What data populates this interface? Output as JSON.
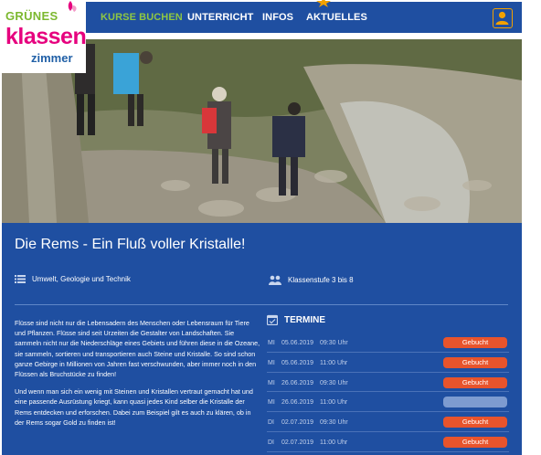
{
  "logo": {
    "line1": "GRÜNES",
    "line2": "klassen",
    "line3": "zimmer"
  },
  "nav": {
    "items": [
      {
        "label": "KURSE BUCHEN",
        "active": true
      },
      {
        "label": "UNTERRICHT",
        "active": false
      },
      {
        "label": "INFOS",
        "active": false
      },
      {
        "label": "AKTUELLES",
        "active": false
      }
    ]
  },
  "course": {
    "title": "Die Rems - Ein Fluß voller Kristalle!",
    "subject": "Umwelt, Geologie und Technik",
    "grade": "Klassenstufe 3 bis 8",
    "description": [
      "Flüsse sind nicht nur die Lebensadern des Menschen oder Lebensraum für Tiere und Pflanzen. Flüsse sind seit Urzeiten die Gestalter von Landschaften. Sie sammeln nicht nur die Niederschläge eines Gebiets und führen diese in die Ozeane, sie sammeln, sortieren und transportieren auch Steine und Kristalle. So sind schon ganze Gebirge in Millionen von Jahren fast verschwunden, aber immer noch in den Flüssen als Bruchstücke zu finden!",
      "Und wenn man sich ein wenig mit Steinen und Kristallen vertraut gemacht hat und eine passende Ausrüstung kriegt, kann quasi jedes Kind selber die Kristalle der Rems entdecken und erforschen. Dabei zum Beispiel gilt es auch zu klären, ob in der Rems sogar Gold zu finden ist!"
    ]
  },
  "termine": {
    "heading": "TERMINE",
    "rows": [
      {
        "day": "MI",
        "date": "05.06.2019",
        "time": "09:30 Uhr",
        "status": "Gebucht"
      },
      {
        "day": "MI",
        "date": "05.06.2019",
        "time": "11:00 Uhr",
        "status": "Gebucht"
      },
      {
        "day": "MI",
        "date": "26.06.2019",
        "time": "09:30 Uhr",
        "status": "Gebucht"
      },
      {
        "day": "MI",
        "date": "26.06.2019",
        "time": "11:00 Uhr",
        "status": ""
      },
      {
        "day": "DI",
        "date": "02.07.2019",
        "time": "09:30 Uhr",
        "status": "Gebucht"
      },
      {
        "day": "DI",
        "date": "02.07.2019",
        "time": "11:00 Uhr",
        "status": "Gebucht"
      }
    ]
  },
  "colors": {
    "brand_blue": "#1f4fa1",
    "accent_green": "#8fc742",
    "badge_orange": "#e8542c",
    "logo_pink": "#e6007e"
  }
}
